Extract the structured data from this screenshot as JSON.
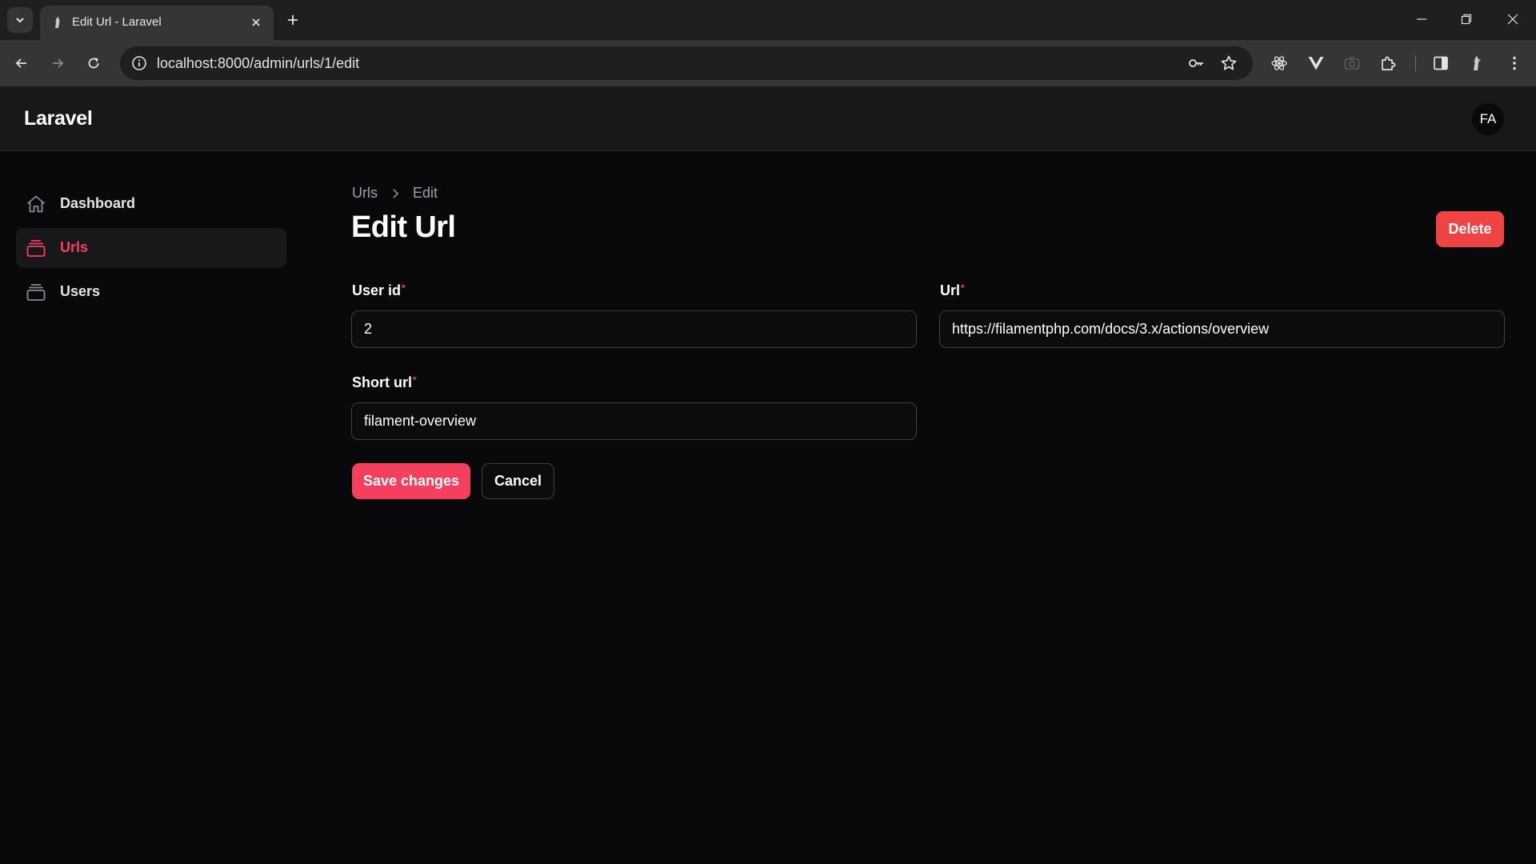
{
  "browser": {
    "tab_title": "Edit Url - Laravel",
    "url": "localhost:8000/admin/urls/1/edit"
  },
  "app": {
    "brand": "Laravel",
    "user_initials": "FA"
  },
  "sidebar": {
    "items": [
      {
        "label": "Dashboard",
        "icon": "home-icon",
        "active": false
      },
      {
        "label": "Urls",
        "icon": "rectangle-stack-icon",
        "active": true
      },
      {
        "label": "Users",
        "icon": "rectangle-stack-icon",
        "active": false
      }
    ]
  },
  "page": {
    "breadcrumbs": [
      "Urls",
      "Edit"
    ],
    "title": "Edit Url",
    "delete_label": "Delete"
  },
  "form": {
    "user_id": {
      "label": "User id",
      "required_mark": "*",
      "value": "2"
    },
    "url": {
      "label": "Url",
      "required_mark": "*",
      "value": "https://filamentphp.com/docs/3.x/actions/overview"
    },
    "short_url": {
      "label": "Short url",
      "required_mark": "*",
      "value": "filament-overview"
    },
    "save_label": "Save changes",
    "cancel_label": "Cancel"
  },
  "colors": {
    "primary": "#f43f5e",
    "danger": "#ef4444",
    "background": "#09090b",
    "topbar": "#18181b"
  }
}
